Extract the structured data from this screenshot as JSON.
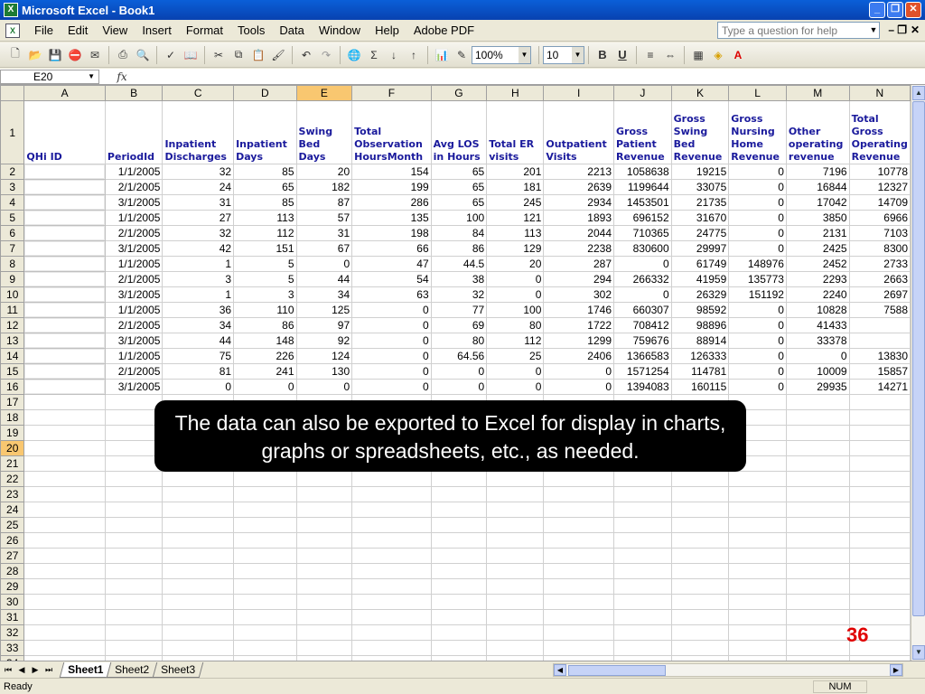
{
  "window": {
    "title": "Microsoft Excel - Book1",
    "app_icon": "excel-icon"
  },
  "menu": {
    "items": [
      "File",
      "Edit",
      "View",
      "Insert",
      "Format",
      "Tools",
      "Data",
      "Window",
      "Help",
      "Adobe PDF"
    ],
    "help_placeholder": "Type a question for help"
  },
  "toolbar": {
    "zoom": "100%",
    "font_size": "10",
    "bold": "B",
    "underline": "U"
  },
  "formula_bar": {
    "cell_ref": "E20",
    "fx": "fx"
  },
  "columns": [
    "A",
    "B",
    "C",
    "D",
    "E",
    "F",
    "G",
    "H",
    "I",
    "J",
    "K",
    "L",
    "M",
    "N"
  ],
  "selected_column": "E",
  "selected_row": "20",
  "headers": [
    "QHi ID",
    "PeriodId",
    "Inpatient Discharges",
    "Inpatient Days",
    "Swing Bed Days",
    "Total Observation HoursMonth",
    "Avg LOS in Hours",
    "Total ER visits",
    "Outpatient Visits",
    "Gross Patient Revenue",
    "Gross Swing Bed Revenue",
    "Gross Nursing Home Revenue",
    "Other operating revenue",
    "Total Gross Operating Revenue"
  ],
  "rows": [
    [
      "",
      "1/1/2005",
      "32",
      "85",
      "20",
      "154",
      "65",
      "201",
      "2213",
      "1058638",
      "19215",
      "0",
      "7196",
      "10778"
    ],
    [
      "",
      "2/1/2005",
      "24",
      "65",
      "182",
      "199",
      "65",
      "181",
      "2639",
      "1199644",
      "33075",
      "0",
      "16844",
      "12327"
    ],
    [
      "",
      "3/1/2005",
      "31",
      "85",
      "87",
      "286",
      "65",
      "245",
      "2934",
      "1453501",
      "21735",
      "0",
      "17042",
      "14709"
    ],
    [
      "",
      "1/1/2005",
      "27",
      "113",
      "57",
      "135",
      "100",
      "121",
      "1893",
      "696152",
      "31670",
      "0",
      "3850",
      "6966"
    ],
    [
      "",
      "2/1/2005",
      "32",
      "112",
      "31",
      "198",
      "84",
      "113",
      "2044",
      "710365",
      "24775",
      "0",
      "2131",
      "7103"
    ],
    [
      "",
      "3/1/2005",
      "42",
      "151",
      "67",
      "66",
      "86",
      "129",
      "2238",
      "830600",
      "29997",
      "0",
      "2425",
      "8300"
    ],
    [
      "",
      "1/1/2005",
      "1",
      "5",
      "0",
      "47",
      "44.5",
      "20",
      "287",
      "0",
      "61749",
      "148976",
      "2452",
      "2733"
    ],
    [
      "",
      "2/1/2005",
      "3",
      "5",
      "44",
      "54",
      "38",
      "0",
      "294",
      "266332",
      "41959",
      "135773",
      "2293",
      "2663"
    ],
    [
      "",
      "3/1/2005",
      "1",
      "3",
      "34",
      "63",
      "32",
      "0",
      "302",
      "0",
      "26329",
      "151192",
      "2240",
      "2697"
    ],
    [
      "",
      "1/1/2005",
      "36",
      "110",
      "125",
      "0",
      "77",
      "100",
      "1746",
      "660307",
      "98592",
      "0",
      "10828",
      "7588"
    ],
    [
      "",
      "2/1/2005",
      "34",
      "86",
      "97",
      "0",
      "69",
      "80",
      "1722",
      "708412",
      "98896",
      "0",
      "41433",
      ""
    ],
    [
      "",
      "3/1/2005",
      "44",
      "148",
      "92",
      "0",
      "80",
      "112",
      "1299",
      "759676",
      "88914",
      "0",
      "33378",
      ""
    ],
    [
      "",
      "1/1/2005",
      "75",
      "226",
      "124",
      "0",
      "64.56",
      "25",
      "2406",
      "1366583",
      "126333",
      "0",
      "0",
      "13830"
    ],
    [
      "",
      "2/1/2005",
      "81",
      "241",
      "130",
      "0",
      "0",
      "0",
      "0",
      "1571254",
      "114781",
      "0",
      "10009",
      "15857"
    ],
    [
      "",
      "3/1/2005",
      "0",
      "0",
      "0",
      "0",
      "0",
      "0",
      "0",
      "1394083",
      "160115",
      "0",
      "29935",
      "14271"
    ]
  ],
  "sheets": [
    "Sheet1",
    "Sheet2",
    "Sheet3"
  ],
  "active_sheet": "Sheet1",
  "status": {
    "left": "Ready",
    "num": "NUM"
  },
  "callout": "The data can also be exported to Excel for display in charts, graphs or spreadsheets, etc., as needed.",
  "slide_number": "36"
}
